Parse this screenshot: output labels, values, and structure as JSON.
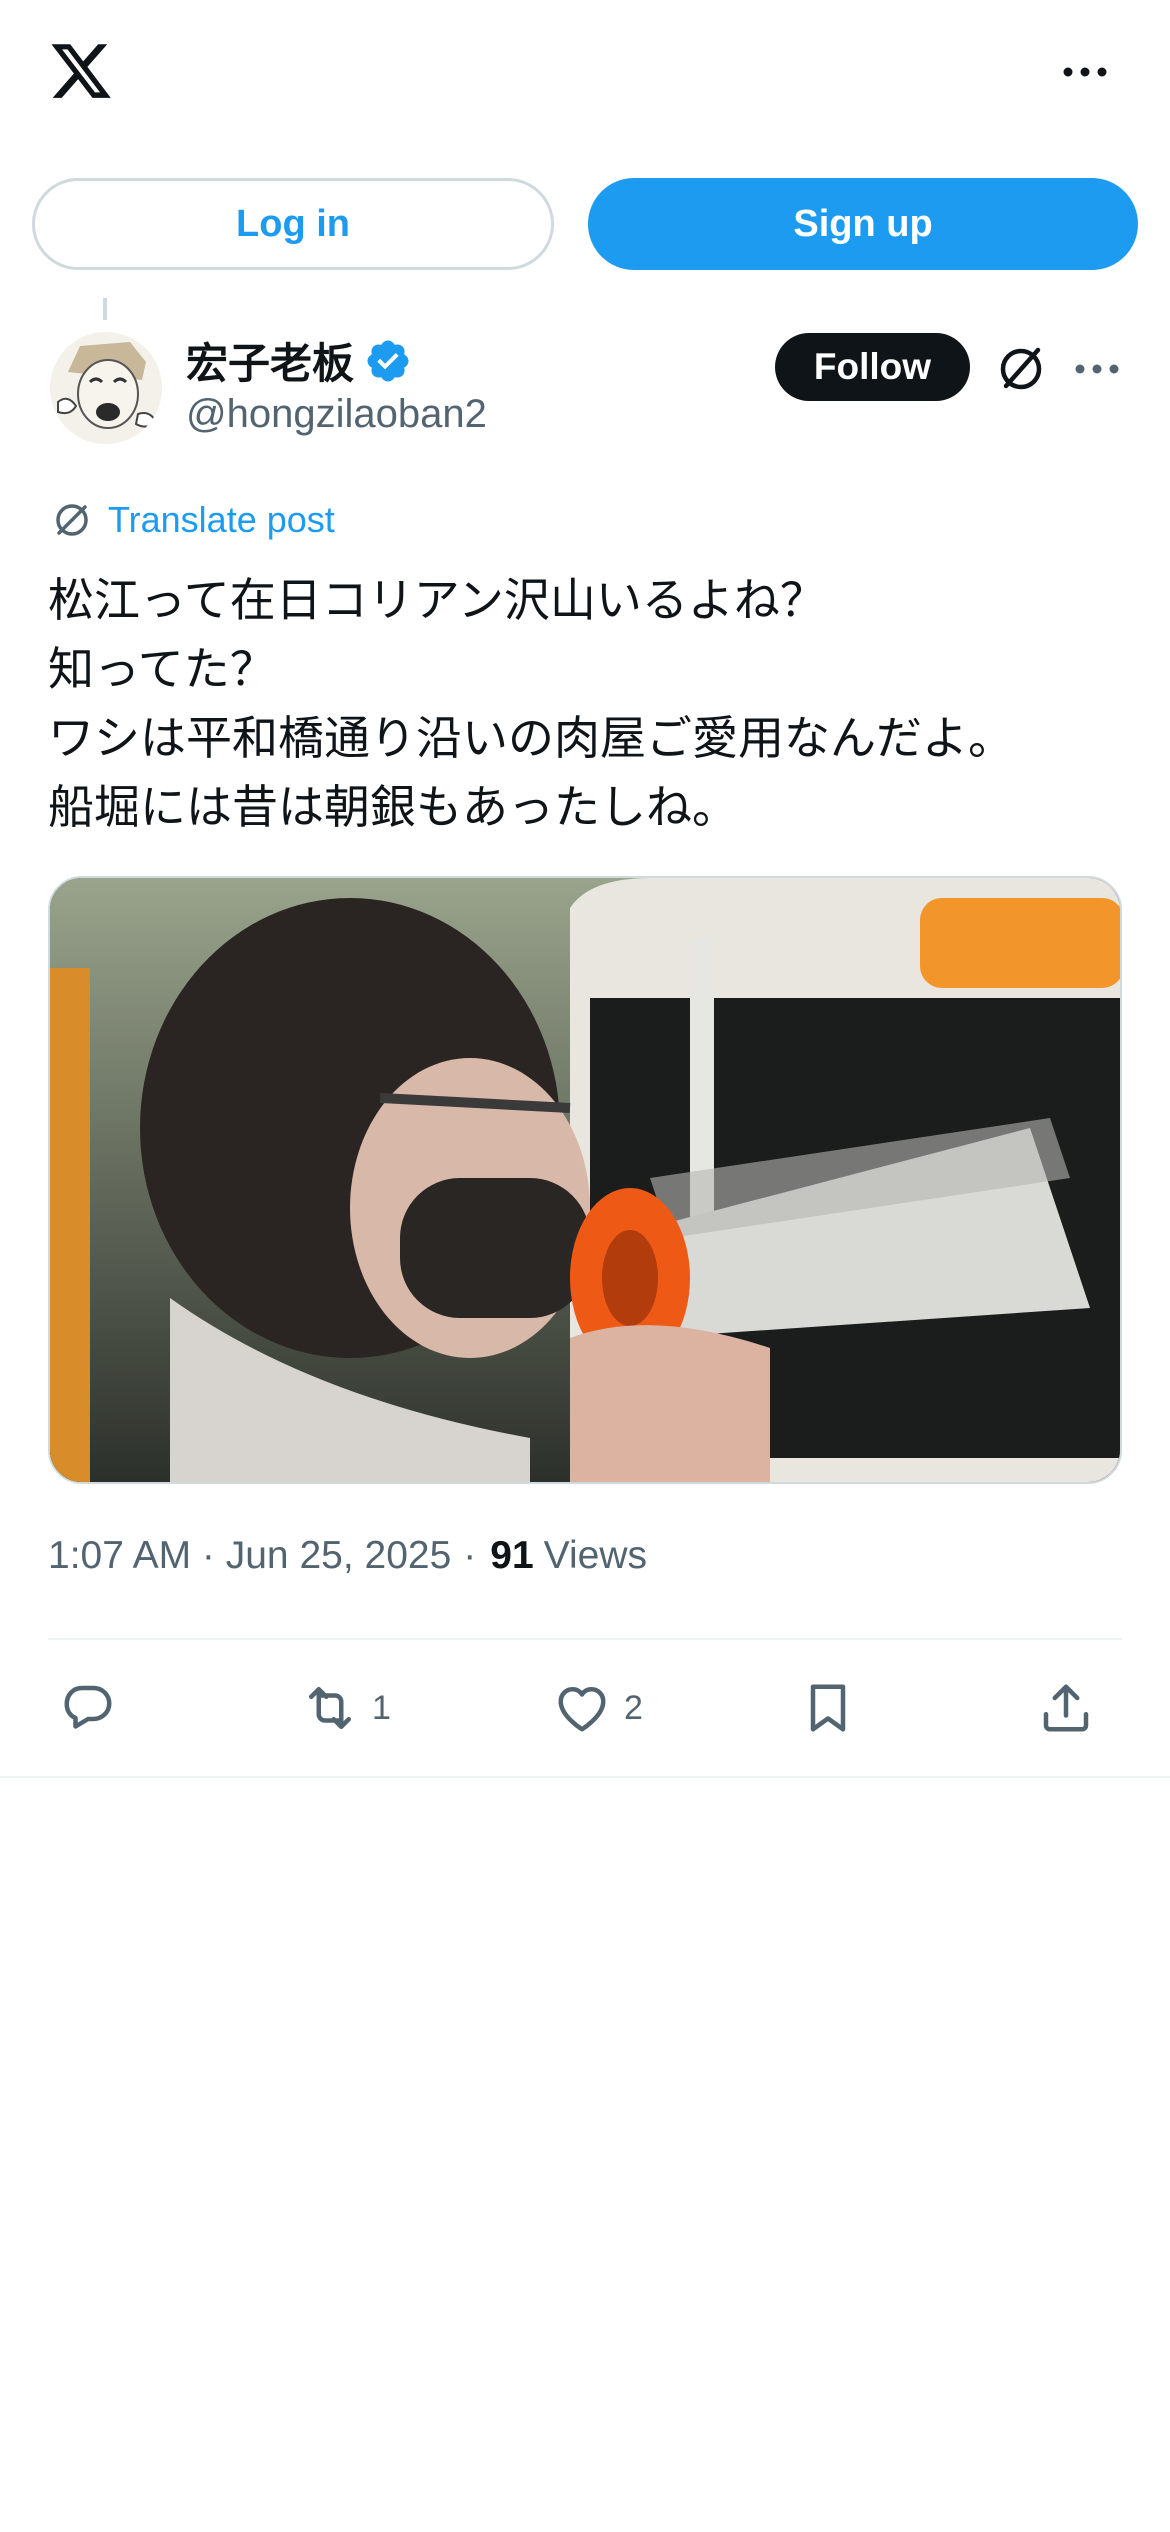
{
  "header": {
    "logo_icon": "x-logo-icon",
    "more_icon": "more-horizontal-icon"
  },
  "auth": {
    "login_label": "Log in",
    "signup_label": "Sign up"
  },
  "post": {
    "author": {
      "display_name": "宏子老板",
      "handle": "@hongzilaoban2",
      "verified": true,
      "avatar_icon": "avatar-icon"
    },
    "follow_label": "Follow",
    "translate_label": "Translate post",
    "text_lines": [
      "松江って在日コリアン沢山いるよね？",
      "知ってた？",
      "ワシは平和橋通り沿いの肉屋ご愛用なんだよ。",
      "船堀には昔は朝銀もあったしね。"
    ],
    "timestamp": "1:07 AM · Jun 25, 2025",
    "separator": "·",
    "views_count": "91",
    "views_label": "Views"
  },
  "actions": {
    "reply_count": "",
    "repost_count": "1",
    "like_count": "2"
  },
  "colors": {
    "accent": "#1d9bf0",
    "text_primary": "#0f1419",
    "text_secondary": "#536471",
    "border": "#cfd9de"
  }
}
